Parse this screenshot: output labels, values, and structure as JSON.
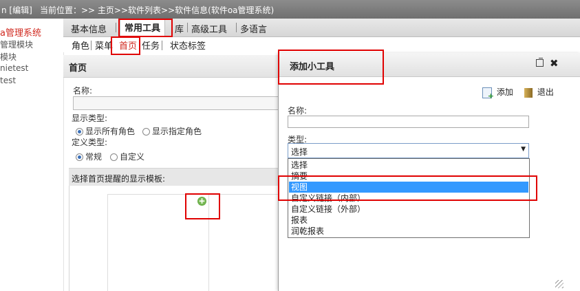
{
  "topbar": {
    "edit_text": "n [编辑]",
    "breadcrumb": "当前位置：>> 主页>>软件列表>>软件信息(软件oa管理系统)"
  },
  "sidebar": {
    "items": [
      {
        "label": "a管理系统",
        "active": true
      },
      {
        "label": "管理模块",
        "active": false
      },
      {
        "label": "模块",
        "active": false
      },
      {
        "label": "nietest",
        "active": false
      },
      {
        "label": "test",
        "active": false
      }
    ]
  },
  "tabs1": {
    "items": [
      "基本信息",
      "常用工具",
      "库",
      "高级工具",
      "多语言"
    ],
    "active": "常用工具"
  },
  "tabs2": {
    "items": [
      "角色",
      "菜单",
      "首页",
      "任务",
      "状态标签"
    ],
    "active": "首页"
  },
  "panel": {
    "title": "首页",
    "name_label": "名称:",
    "display_type_label": "显示类型:",
    "display_options": [
      "显示所有角色",
      "显示指定角色"
    ],
    "define_type_label": "定义类型:",
    "define_options": [
      "常规",
      "自定义"
    ],
    "template_section": "选择首页提醒的显示模板:",
    "add_icon": "plus-icon"
  },
  "dialog": {
    "title": "添加小工具",
    "add_button": "添加",
    "exit_button": "退出",
    "name_label": "名称:",
    "name_value": "",
    "type_label": "类型:",
    "type_selected": "选择",
    "type_options": [
      "选择",
      "摘要",
      "视图",
      "自定义链接（内部）",
      "自定义链接（外部）",
      "报表",
      "润乾报表"
    ],
    "highlighted_option": "视图"
  },
  "colors": {
    "accent_red": "#e00000",
    "active_link": "#d0281e",
    "selection_blue": "#3399ff"
  }
}
